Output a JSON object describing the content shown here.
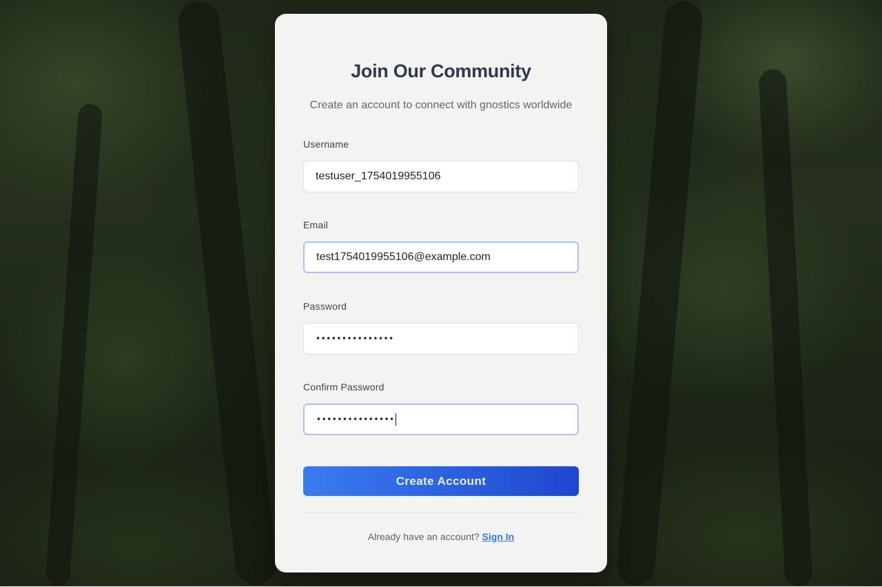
{
  "card": {
    "title": "Join Our Community",
    "subtitle": "Create an account to connect with gnostics worldwide"
  },
  "form": {
    "username": {
      "label": "Username",
      "value": "testuser_1754019955106"
    },
    "email": {
      "label": "Email",
      "value": "test1754019955106@example.com"
    },
    "password": {
      "label": "Password",
      "value": "•••••••••••••••"
    },
    "confirm_password": {
      "label": "Confirm Password",
      "value": "•••••••••••••••"
    },
    "submit_label": "Create Account"
  },
  "footer": {
    "prompt": "Already have an account?",
    "signin_label": "Sign In"
  },
  "colors": {
    "accent": "#2c63e0",
    "title": "#2b3a4e",
    "link": "#3677e6"
  }
}
